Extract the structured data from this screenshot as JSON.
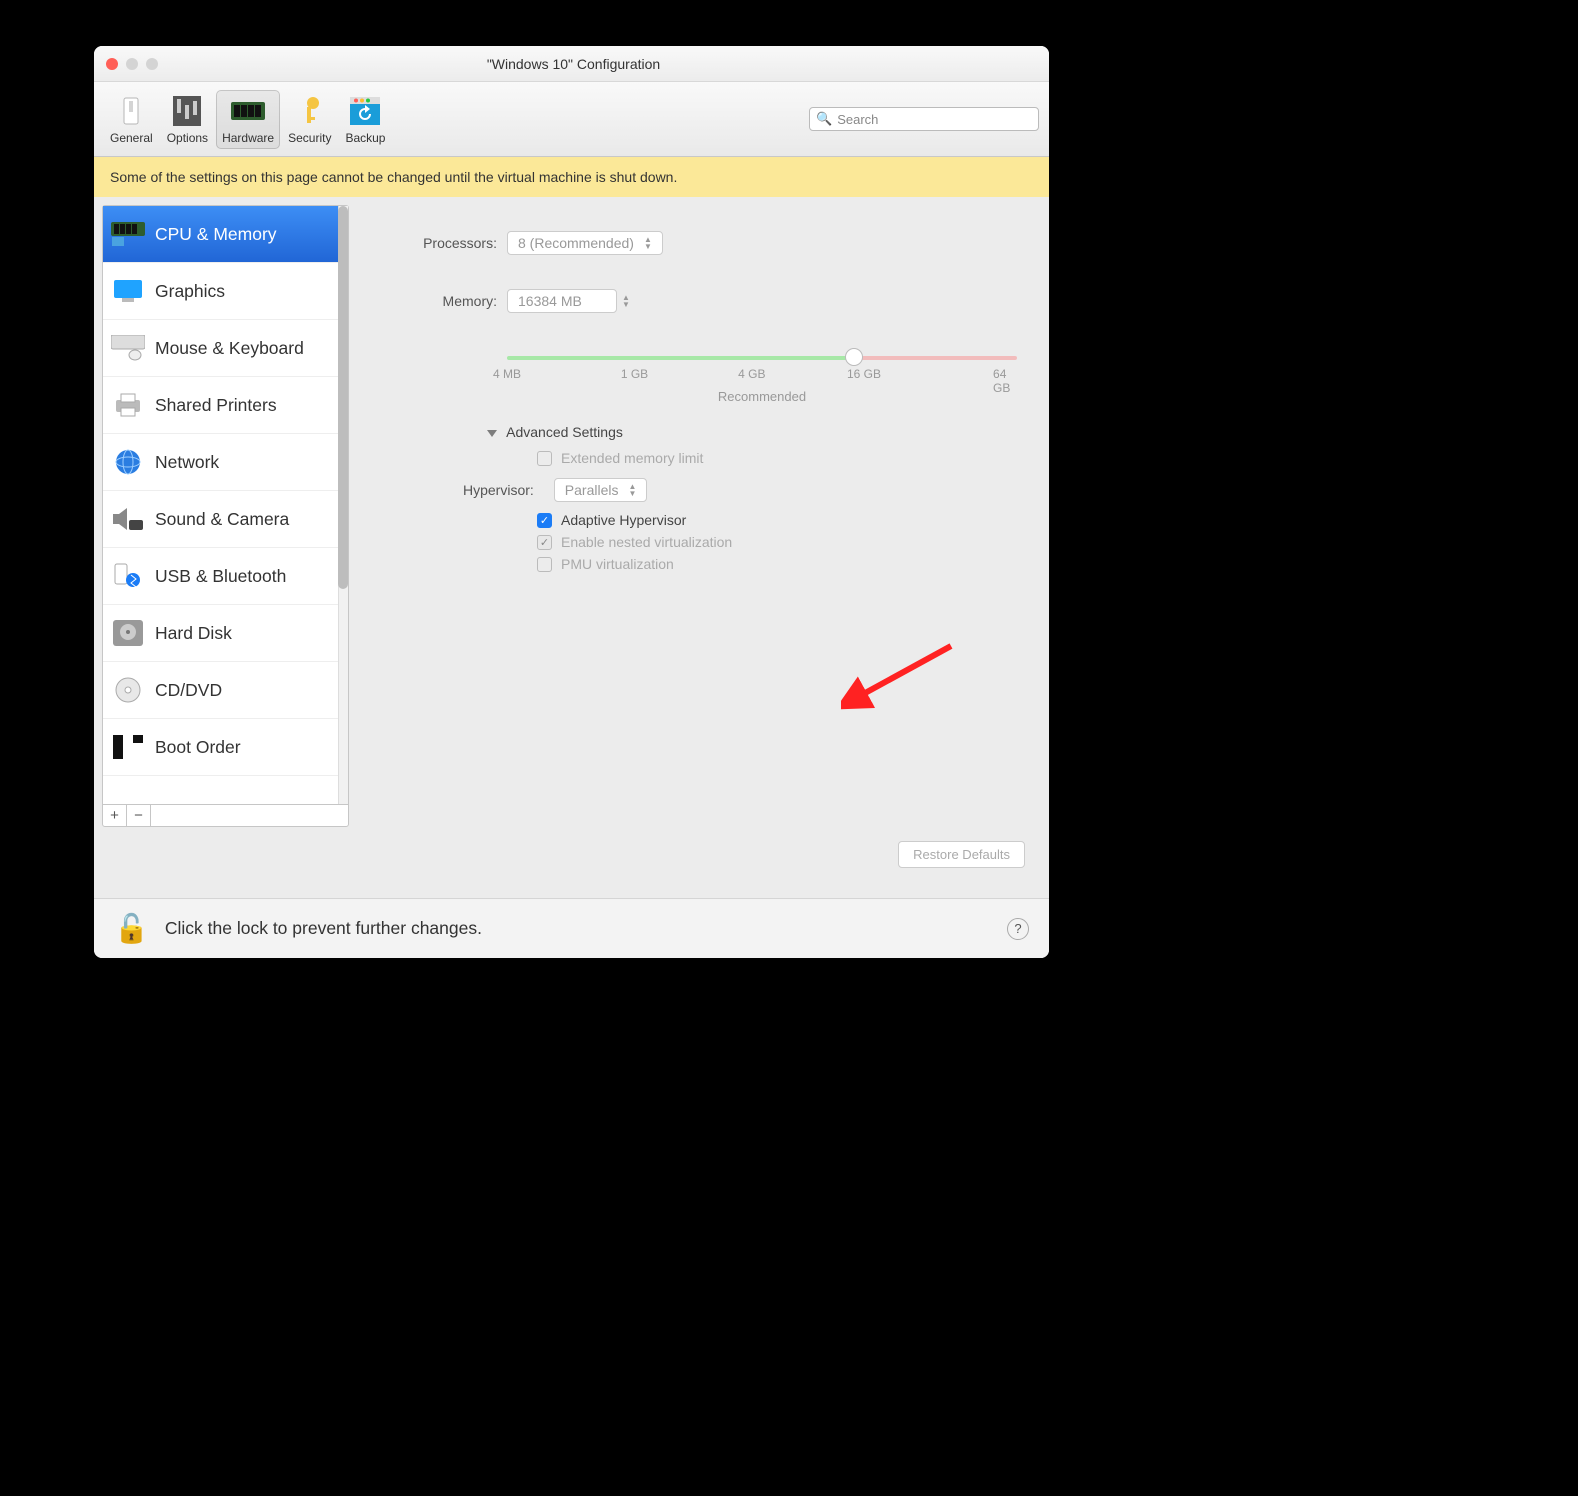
{
  "window": {
    "title": "\"Windows 10\" Configuration"
  },
  "toolbar": {
    "items": [
      {
        "label": "General"
      },
      {
        "label": "Options"
      },
      {
        "label": "Hardware"
      },
      {
        "label": "Security"
      },
      {
        "label": "Backup"
      }
    ],
    "search_placeholder": "Search"
  },
  "banner": "Some of the settings on this page cannot be changed until the virtual machine is shut down.",
  "sidebar": {
    "items": [
      "CPU & Memory",
      "Graphics",
      "Mouse & Keyboard",
      "Shared Printers",
      "Network",
      "Sound & Camera",
      "USB & Bluetooth",
      "Hard Disk",
      "CD/DVD",
      "Boot Order"
    ]
  },
  "panel": {
    "processors_label": "Processors:",
    "processors_value": "8 (Recommended)",
    "memory_label": "Memory:",
    "memory_value": "16384 MB",
    "slider_ticks": [
      "4 MB",
      "1 GB",
      "4 GB",
      "16 GB",
      "64 GB"
    ],
    "recommended": "Recommended",
    "advanced_title": "Advanced Settings",
    "extended_memory": "Extended memory limit",
    "hypervisor_label": "Hypervisor:",
    "hypervisor_value": "Parallels",
    "adaptive": "Adaptive Hypervisor",
    "nested": "Enable nested virtualization",
    "pmu": "PMU virtualization",
    "restore": "Restore Defaults"
  },
  "footer": {
    "lock_text": "Click the lock to prevent further changes."
  }
}
